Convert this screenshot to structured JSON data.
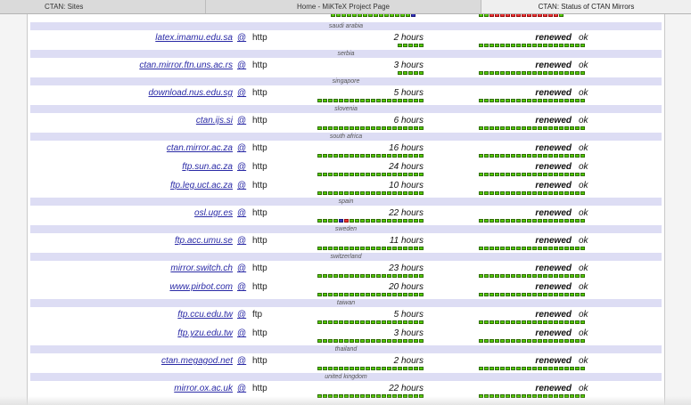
{
  "tabs": [
    {
      "label": "CTAN: Sites",
      "active": false
    },
    {
      "label": "Home - MiKTeX Project Page",
      "active": false
    },
    {
      "label": "CTAN: Status of CTAN Mirrors",
      "active": true
    }
  ],
  "colors": {
    "country_band": "#ddddf4",
    "link": "#2a2aa6",
    "ok_cell": "#55cc00",
    "bad_cell": "#ee3333",
    "partial_cell": "#3333bb"
  },
  "at_symbol": "@",
  "top_partial_row": {
    "sync_bar": [
      "g",
      "g",
      "g",
      "g",
      "g",
      "g",
      "g",
      "g",
      "g",
      "g",
      "g",
      "g",
      "g",
      "g",
      "g",
      "b"
    ],
    "renew_bar": [
      "g",
      "g",
      "r",
      "r",
      "r",
      "r",
      "r",
      "r",
      "r",
      "r",
      "r",
      "r",
      "r",
      "r",
      "r",
      "g"
    ]
  },
  "groups": [
    {
      "country": "saudi arabia",
      "mirrors": [
        {
          "host": "latex.imamu.edu.sa",
          "protocol": "http",
          "age": "2 hours",
          "status": "renewed",
          "result": "ok",
          "sync_bar": [
            "g",
            "g",
            "g",
            "g",
            "g"
          ],
          "renew_bar": [
            "g",
            "g",
            "g",
            "g",
            "g",
            "g",
            "g",
            "g",
            "g",
            "g",
            "g",
            "g",
            "g",
            "g",
            "g",
            "g",
            "g",
            "g",
            "g",
            "g"
          ]
        }
      ]
    },
    {
      "country": "serbia",
      "mirrors": [
        {
          "host": "ctan.mirror.ftn.uns.ac.rs",
          "protocol": "http",
          "age": "3 hours",
          "status": "renewed",
          "result": "ok",
          "sync_bar": [
            "g",
            "g",
            "g",
            "g",
            "g"
          ],
          "renew_bar": [
            "g",
            "g",
            "g",
            "g",
            "g",
            "g",
            "g",
            "g",
            "g",
            "g",
            "g",
            "g",
            "g",
            "g",
            "g",
            "g",
            "g",
            "g",
            "g",
            "g"
          ]
        }
      ]
    },
    {
      "country": "singapore",
      "mirrors": [
        {
          "host": "download.nus.edu.sg",
          "protocol": "http",
          "age": "5 hours",
          "status": "renewed",
          "result": "ok",
          "sync_bar": [
            "g",
            "g",
            "g",
            "g",
            "g",
            "g",
            "g",
            "g",
            "g",
            "g",
            "g",
            "g",
            "g",
            "g",
            "g",
            "g",
            "g",
            "g",
            "g",
            "g"
          ],
          "renew_bar": [
            "g",
            "g",
            "g",
            "g",
            "g",
            "g",
            "g",
            "g",
            "g",
            "g",
            "g",
            "g",
            "g",
            "g",
            "g",
            "g",
            "g",
            "g",
            "g",
            "g"
          ]
        }
      ]
    },
    {
      "country": "slovenia",
      "mirrors": [
        {
          "host": "ctan.ijs.si",
          "protocol": "http",
          "age": "6 hours",
          "status": "renewed",
          "result": "ok",
          "sync_bar": [
            "g",
            "g",
            "g",
            "g",
            "g",
            "g",
            "g",
            "g",
            "g",
            "g",
            "g",
            "g",
            "g",
            "g",
            "g",
            "g",
            "g",
            "g",
            "g",
            "g"
          ],
          "renew_bar": [
            "g",
            "g",
            "g",
            "g",
            "g",
            "g",
            "g",
            "g",
            "g",
            "g",
            "g",
            "g",
            "g",
            "g",
            "g",
            "g",
            "g",
            "g",
            "g",
            "g"
          ]
        }
      ]
    },
    {
      "country": "south africa",
      "mirrors": [
        {
          "host": "ctan.mirror.ac.za",
          "protocol": "http",
          "age": "16 hours",
          "status": "renewed",
          "result": "ok",
          "sync_bar": [
            "g",
            "g",
            "g",
            "g",
            "g",
            "g",
            "g",
            "g",
            "g",
            "g",
            "g",
            "g",
            "g",
            "g",
            "g",
            "g",
            "g",
            "g",
            "g",
            "g"
          ],
          "renew_bar": [
            "g",
            "g",
            "g",
            "g",
            "g",
            "g",
            "g",
            "g",
            "g",
            "g",
            "g",
            "g",
            "g",
            "g",
            "g",
            "g",
            "g",
            "g",
            "g",
            "g"
          ]
        },
        {
          "host": "ftp.sun.ac.za",
          "protocol": "http",
          "age": "24 hours",
          "status": "renewed",
          "result": "ok",
          "sync_bar": [
            "g",
            "g",
            "g",
            "g",
            "g",
            "g",
            "g",
            "g",
            "g",
            "g",
            "g",
            "g",
            "g",
            "g",
            "g",
            "g",
            "g",
            "g",
            "g",
            "g"
          ],
          "renew_bar": [
            "g",
            "g",
            "g",
            "g",
            "g",
            "g",
            "g",
            "g",
            "g",
            "g",
            "g",
            "g",
            "g",
            "g",
            "g",
            "g",
            "g",
            "g",
            "g",
            "g"
          ]
        },
        {
          "host": "ftp.leg.uct.ac.za",
          "protocol": "http",
          "age": "10 hours",
          "status": "renewed",
          "result": "ok",
          "sync_bar": [
            "g",
            "g",
            "g",
            "g",
            "g",
            "g",
            "g",
            "g",
            "g",
            "g",
            "g",
            "g",
            "g",
            "g",
            "g",
            "g",
            "g",
            "g",
            "g",
            "g"
          ],
          "renew_bar": [
            "g",
            "g",
            "g",
            "g",
            "g",
            "g",
            "g",
            "g",
            "g",
            "g",
            "g",
            "g",
            "g",
            "g",
            "g",
            "g",
            "g",
            "g",
            "g",
            "g"
          ]
        }
      ]
    },
    {
      "country": "spain",
      "mirrors": [
        {
          "host": "osl.ugr.es",
          "protocol": "http",
          "age": "22 hours",
          "status": "renewed",
          "result": "ok",
          "sync_bar": [
            "g",
            "g",
            "g",
            "g",
            "b",
            "r",
            "g",
            "g",
            "g",
            "g",
            "g",
            "g",
            "g",
            "g",
            "g",
            "g",
            "g",
            "g",
            "g",
            "g"
          ],
          "renew_bar": [
            "g",
            "g",
            "g",
            "g",
            "g",
            "g",
            "g",
            "g",
            "g",
            "g",
            "g",
            "g",
            "g",
            "g",
            "g",
            "g",
            "g",
            "g",
            "g",
            "g"
          ]
        }
      ]
    },
    {
      "country": "sweden",
      "mirrors": [
        {
          "host": "ftp.acc.umu.se",
          "protocol": "http",
          "age": "11 hours",
          "status": "renewed",
          "result": "ok",
          "sync_bar": [
            "g",
            "g",
            "g",
            "g",
            "g",
            "g",
            "g",
            "g",
            "g",
            "g",
            "g",
            "g",
            "g",
            "g",
            "g",
            "g",
            "g",
            "g",
            "g",
            "g"
          ],
          "renew_bar": [
            "g",
            "g",
            "g",
            "g",
            "g",
            "g",
            "g",
            "g",
            "g",
            "g",
            "g",
            "g",
            "g",
            "g",
            "g",
            "g",
            "g",
            "g",
            "g",
            "g"
          ]
        }
      ]
    },
    {
      "country": "switzerland",
      "mirrors": [
        {
          "host": "mirror.switch.ch",
          "protocol": "http",
          "age": "23 hours",
          "status": "renewed",
          "result": "ok",
          "sync_bar": [
            "g",
            "g",
            "g",
            "g",
            "g",
            "g",
            "g",
            "g",
            "g",
            "g",
            "g",
            "g",
            "g",
            "g",
            "g",
            "g",
            "g",
            "g",
            "g",
            "g"
          ],
          "renew_bar": [
            "g",
            "g",
            "g",
            "g",
            "g",
            "g",
            "g",
            "g",
            "g",
            "g",
            "g",
            "g",
            "g",
            "g",
            "g",
            "g",
            "g",
            "g",
            "g",
            "g"
          ]
        },
        {
          "host": "www.pirbot.com",
          "protocol": "http",
          "age": "20 hours",
          "status": "renewed",
          "result": "ok",
          "sync_bar": [
            "g",
            "g",
            "g",
            "g",
            "g",
            "g",
            "g",
            "g",
            "g",
            "g",
            "g",
            "g",
            "g",
            "g",
            "g",
            "g",
            "g",
            "g",
            "g",
            "g"
          ],
          "renew_bar": [
            "g",
            "g",
            "g",
            "g",
            "g",
            "g",
            "g",
            "g",
            "g",
            "g",
            "g",
            "g",
            "g",
            "g",
            "g",
            "g",
            "g",
            "g",
            "g",
            "g"
          ]
        }
      ]
    },
    {
      "country": "taiwan",
      "mirrors": [
        {
          "host": "ftp.ccu.edu.tw",
          "protocol": "ftp",
          "age": "5 hours",
          "status": "renewed",
          "result": "ok",
          "sync_bar": [
            "g",
            "g",
            "g",
            "g",
            "g",
            "g",
            "g",
            "g",
            "g",
            "g",
            "g",
            "g",
            "g",
            "g",
            "g",
            "g",
            "g",
            "g",
            "g",
            "g"
          ],
          "renew_bar": [
            "g",
            "g",
            "g",
            "g",
            "g",
            "g",
            "g",
            "g",
            "g",
            "g",
            "g",
            "g",
            "g",
            "g",
            "g",
            "g",
            "g",
            "g",
            "g",
            "g"
          ]
        },
        {
          "host": "ftp.yzu.edu.tw",
          "protocol": "http",
          "age": "3 hours",
          "status": "renewed",
          "result": "ok",
          "sync_bar": [
            "g",
            "g",
            "g",
            "g",
            "g",
            "g",
            "g",
            "g",
            "g",
            "g",
            "g",
            "g",
            "g",
            "g",
            "g",
            "g",
            "g",
            "g",
            "g",
            "g"
          ],
          "renew_bar": [
            "g",
            "g",
            "g",
            "g",
            "g",
            "g",
            "g",
            "g",
            "g",
            "g",
            "g",
            "g",
            "g",
            "g",
            "g",
            "g",
            "g",
            "g",
            "g",
            "g"
          ]
        }
      ]
    },
    {
      "country": "thailand",
      "mirrors": [
        {
          "host": "ctan.megagod.net",
          "protocol": "http",
          "age": "2 hours",
          "status": "renewed",
          "result": "ok",
          "sync_bar": [
            "g",
            "g",
            "g",
            "g",
            "g",
            "g",
            "g",
            "g",
            "g",
            "g",
            "g",
            "g",
            "g",
            "g",
            "g",
            "g",
            "g",
            "g",
            "g",
            "g"
          ],
          "renew_bar": [
            "g",
            "g",
            "g",
            "g",
            "g",
            "g",
            "g",
            "g",
            "g",
            "g",
            "g",
            "g",
            "g",
            "g",
            "g",
            "g",
            "g",
            "g",
            "g",
            "g"
          ]
        }
      ]
    },
    {
      "country": "united kingdom",
      "mirrors": [
        {
          "host": "mirror.ox.ac.uk",
          "protocol": "http",
          "age": "22 hours",
          "status": "renewed",
          "result": "ok",
          "sync_bar": [
            "g",
            "g",
            "g",
            "g",
            "g",
            "g",
            "g",
            "g",
            "g",
            "g",
            "g",
            "g",
            "g",
            "g",
            "g",
            "g",
            "g",
            "g",
            "g",
            "g"
          ],
          "renew_bar": [
            "g",
            "g",
            "g",
            "g",
            "g",
            "g",
            "g",
            "g",
            "g",
            "g",
            "g",
            "g",
            "g",
            "g",
            "g",
            "g",
            "g",
            "g",
            "g",
            "g"
          ]
        }
      ]
    }
  ]
}
